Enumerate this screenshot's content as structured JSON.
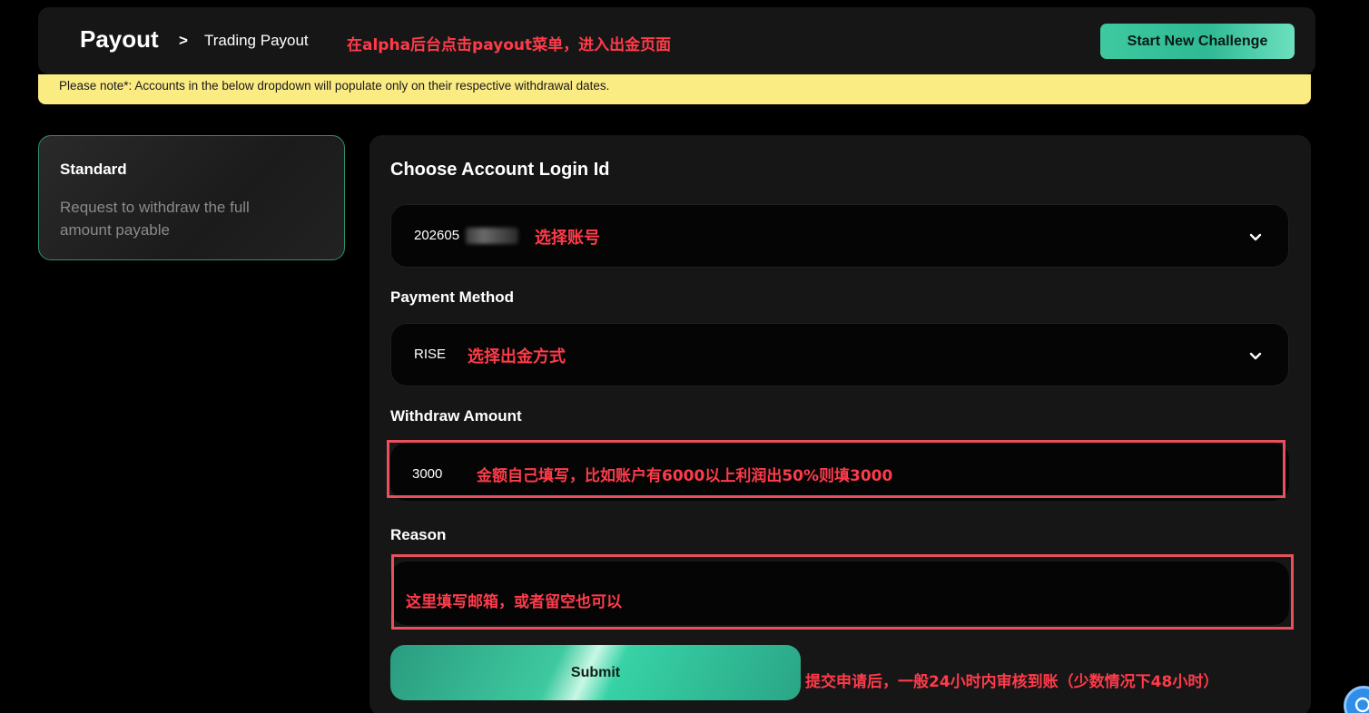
{
  "header": {
    "breadcrumb_title": "Payout",
    "breadcrumb_separator": ">",
    "breadcrumb_current": "Trading Payout",
    "annotation": "在alpha后台点击payout菜单，进入出金页面",
    "start_button_label": "Start New Challenge"
  },
  "notice": {
    "text": "Please note*: Accounts in the below dropdown will populate only on their respective withdrawal dates."
  },
  "sidebar": {
    "title": "Standard",
    "description": "Request to withdraw the full amount payable"
  },
  "form": {
    "account_label": "Choose Account Login Id",
    "account_value": "202605",
    "account_annotation": "选择账号",
    "payment_label": "Payment Method",
    "payment_value": "RISE",
    "payment_annotation": "选择出金方式",
    "amount_label": "Withdraw Amount",
    "amount_value": "3000",
    "amount_annotation": "金额自己填写，比如账户有6000以上利润出50%则填3000",
    "reason_label": "Reason",
    "reason_annotation": "这里填写邮箱，或者留空也可以",
    "submit_label": "Submit",
    "submit_annotation": "提交申请后，一般24小时内审核到账（少数情况下48小时）"
  },
  "colors": {
    "accent": "#3ec9a0",
    "notice_bg": "#fbeb83",
    "annotation_red": "#ff3b4a"
  },
  "icons": [
    "chevron-down-icon",
    "chat-icon"
  ]
}
